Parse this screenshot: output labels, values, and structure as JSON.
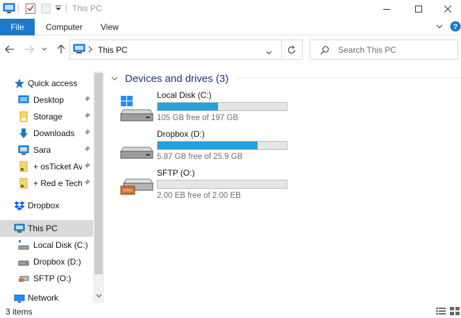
{
  "window": {
    "title": "This PC",
    "minimize_icon": "minimize-icon",
    "maximize_icon": "maximize-icon",
    "close_icon": "close-icon"
  },
  "ribbon": {
    "tabs": [
      {
        "label": "File",
        "active": true
      },
      {
        "label": "Computer"
      },
      {
        "label": "View"
      }
    ],
    "accent_color": "#1979ca"
  },
  "address": {
    "path": "This PC",
    "search_placeholder": "Search This PC"
  },
  "nav": {
    "items": [
      {
        "label": "Quick access",
        "icon": "star-icon"
      },
      {
        "label": "Desktop",
        "icon": "desktop-folder-icon",
        "pinned": true
      },
      {
        "label": "Storage",
        "icon": "folder-icon",
        "pinned": true
      },
      {
        "label": "Downloads",
        "icon": "download-icon",
        "pinned": true
      },
      {
        "label": "Sara",
        "icon": "computer-folder-icon",
        "pinned": true
      },
      {
        "label": "+ osTicket Av",
        "icon": "folder-icon",
        "pinned": true
      },
      {
        "label": "+ Red e Techr",
        "icon": "folder-icon",
        "pinned": true
      },
      {
        "label": "Dropbox",
        "icon": "dropbox-icon"
      },
      {
        "label": "This PC",
        "icon": "computer-icon",
        "selected": true
      },
      {
        "label": "Local Disk (C:)",
        "icon": "drive-c-icon"
      },
      {
        "label": "Dropbox (D:)",
        "icon": "drive-icon"
      },
      {
        "label": "SFTP (O:)",
        "icon": "sftp-drive-icon"
      },
      {
        "label": "Network",
        "icon": "network-icon"
      }
    ]
  },
  "content": {
    "group_title": "Devices and drives (3)",
    "drives": [
      {
        "name": "Local Disk (C:)",
        "free_text": "105 GB free of 197 GB",
        "used_fraction": 0.467,
        "icon": "windows-drive-icon"
      },
      {
        "name": "Dropbox (D:)",
        "free_text": "5.87 GB free of 25.9 GB",
        "used_fraction": 0.773,
        "icon": "drive-icon"
      },
      {
        "name": "SFTP (O:)",
        "free_text": "2.00 EB free of 2.00 EB",
        "used_fraction": 0.0,
        "icon": "sftp-drive-icon"
      }
    ],
    "bar_color": "#26a0da"
  },
  "status": {
    "item_count": "3 items"
  }
}
